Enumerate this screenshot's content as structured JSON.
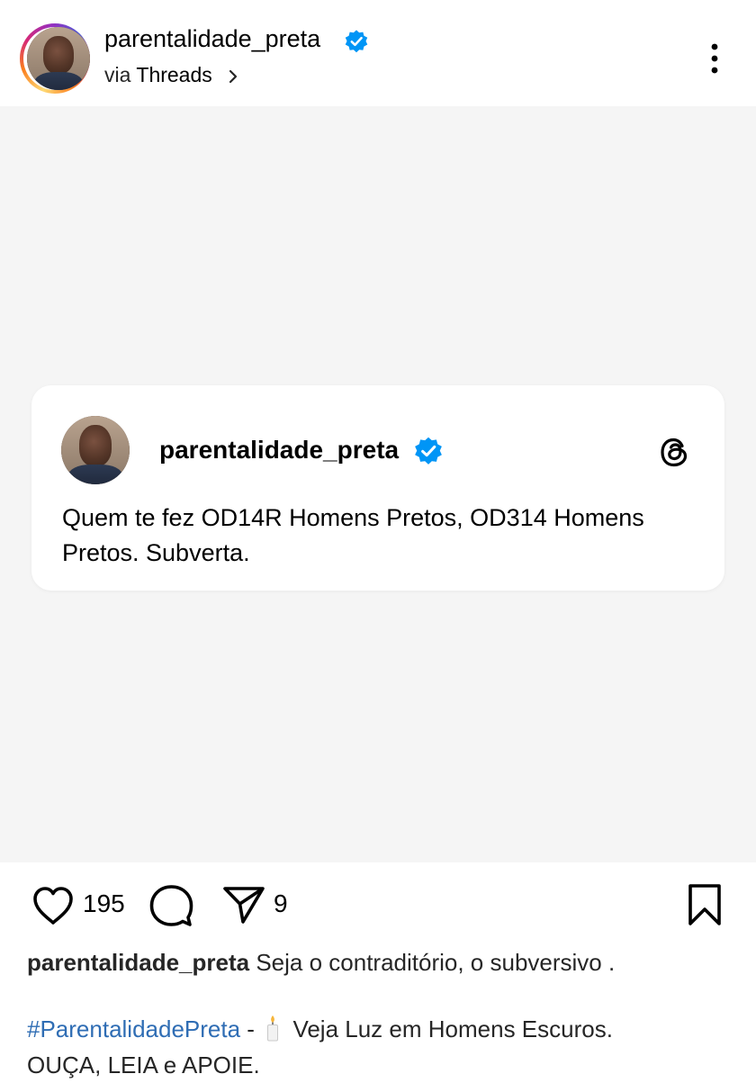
{
  "header": {
    "username": "parentalidade_preta",
    "via_prefix": "via",
    "via_app": "Threads"
  },
  "thread_card": {
    "username": "parentalidade_preta",
    "text": "Quem te fez OD14R Homens Pretos, OD314 Homens Pretos. Subverta."
  },
  "actions": {
    "like_count": "195",
    "share_count": "9"
  },
  "caption": {
    "username": "parentalidade_preta",
    "text": "Seja o contraditório, o subversivo .",
    "hashtag": "#ParentalidadePreta",
    "separator": "-",
    "line2_text": "Veja Luz em Homens Escuros.",
    "line3_text": "OUÇA, LEIA e APOIE."
  },
  "icons": {
    "verified": "verified-badge-icon",
    "more": "more-vertical-icon",
    "threads": "threads-logo-icon",
    "like": "heart-icon",
    "comment": "comment-icon",
    "share": "share-icon",
    "save": "bookmark-icon",
    "candle": "candle-icon"
  },
  "colors": {
    "verified_blue": "#0095f6",
    "hashtag_blue": "#2f6db4",
    "media_background": "#f5f5f5"
  }
}
